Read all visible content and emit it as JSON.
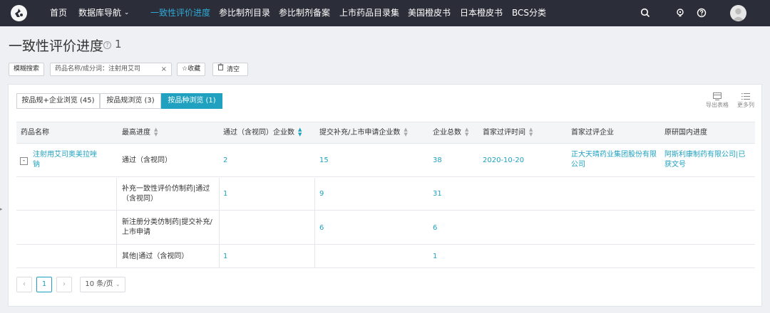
{
  "nav": {
    "items": [
      "首页",
      "数据库导航",
      "一致性评价进度",
      "参比制剂目录",
      "参比制剂备案",
      "上市药品目录集",
      "美国橙皮书",
      "日本橙皮书",
      "BCS分类"
    ],
    "dropdown_arrow": "⌄"
  },
  "page": {
    "title": "一致性评价进度",
    "help": "?",
    "count": "1"
  },
  "filters": {
    "fuzzy_search": "模糊搜索",
    "tag_text": "药品名称/成分词：注射用艾司",
    "tag_close": "×",
    "favorite": "☆收藏",
    "clear": "清空"
  },
  "tabs": [
    "按品规+企业浏览 (45)",
    "按品规浏览 (3)",
    "按品种浏览 (1)"
  ],
  "tools": {
    "export": "导出表格",
    "more_columns": "更多列"
  },
  "table": {
    "headers": [
      "药品名称",
      "最高进度",
      "通过（含视同）企业数",
      "提交补充/上市申请企业数",
      "企业总数",
      "首家过评时间",
      "首家过评企业",
      "原研国内进度"
    ],
    "drug_name": "注射用艾司奥美拉唑钠",
    "expand": "-",
    "rows": [
      {
        "progress": "通过（含视同）",
        "passed": "2",
        "submitted": "15",
        "total": "38",
        "first_time": "2020-10-20",
        "first_company": "正大天晴药业集团股份有限公司",
        "original": "阿斯利康制药有限公司|已获文号"
      },
      {
        "progress": "补充一致性评价仿制药|通过（含视同）",
        "passed": "1",
        "submitted": "9",
        "total": "31",
        "first_time": "",
        "first_company": "",
        "original": ""
      },
      {
        "progress": "新注册分类仿制药|提交补充/上市申请",
        "passed": "",
        "submitted": "6",
        "total": "6",
        "first_time": "",
        "first_company": "",
        "original": ""
      },
      {
        "progress": "其他|通过（含视同）",
        "passed": "1",
        "submitted": "",
        "total": "1",
        "first_time": "",
        "first_company": "",
        "original": ""
      }
    ]
  },
  "pagination": {
    "prev": "‹",
    "current": "1",
    "next": "›",
    "page_size": "10 条/页"
  },
  "colors": {
    "nav_bg": "#2b2d38",
    "accent": "#1fa1bf",
    "nav_active": "#2fa9d6"
  }
}
